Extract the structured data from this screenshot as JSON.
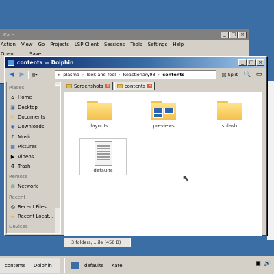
{
  "kate": {
    "title": "Kate",
    "menu": [
      "Action",
      "View",
      "Go",
      "Projects",
      "LSP Client",
      "Sessions",
      "Tools",
      "Settings",
      "Help"
    ],
    "toolbar_labels": [
      "Open",
      "Save"
    ]
  },
  "dolphin": {
    "title": "contents — Dolphin",
    "breadcrumb": [
      "plasma",
      "look-and-feel",
      "Reactionary98",
      "contents"
    ],
    "split_label": "Split",
    "places": {
      "places_header": "Places",
      "places_items": [
        {
          "label": "Home",
          "icon": "home-icon"
        },
        {
          "label": "Desktop",
          "icon": "desktop-icon"
        },
        {
          "label": "Documents",
          "icon": "documents-icon"
        },
        {
          "label": "Downloads",
          "icon": "downloads-icon"
        },
        {
          "label": "Music",
          "icon": "music-icon"
        },
        {
          "label": "Pictures",
          "icon": "pictures-icon"
        },
        {
          "label": "Videos",
          "icon": "videos-icon"
        },
        {
          "label": "Trash",
          "icon": "trash-icon"
        }
      ],
      "remote_header": "Remote",
      "remote_items": [
        {
          "label": "Network",
          "icon": "network-icon"
        }
      ],
      "recent_header": "Recent",
      "recent_items": [
        {
          "label": "Recent Files",
          "icon": "recent-files-icon"
        },
        {
          "label": "Recent Locat...",
          "icon": "recent-locations-icon"
        }
      ],
      "devices_header": "Devices"
    },
    "tabs": [
      {
        "label": "Screenshots",
        "active": false
      },
      {
        "label": "contents",
        "active": true
      }
    ],
    "files": [
      {
        "name": "layouts",
        "type": "folder"
      },
      {
        "name": "previews",
        "type": "folder-images"
      },
      {
        "name": "splash",
        "type": "folder"
      },
      {
        "name": "defaults",
        "type": "document",
        "selected": true
      }
    ],
    "status": "3 folders, ...ile (458 B)"
  },
  "taskbar": {
    "tasks": [
      {
        "label": "contents — Dolphin",
        "pressed": true
      },
      {
        "label": "defaults — Kate",
        "pressed": false
      }
    ]
  },
  "colors": {
    "desktop": "#3a6ea5",
    "title_active_start": "#0a246a",
    "title_active_end": "#a6caf0",
    "folder": "#f2c14c",
    "tab_close": "#e0603a"
  }
}
